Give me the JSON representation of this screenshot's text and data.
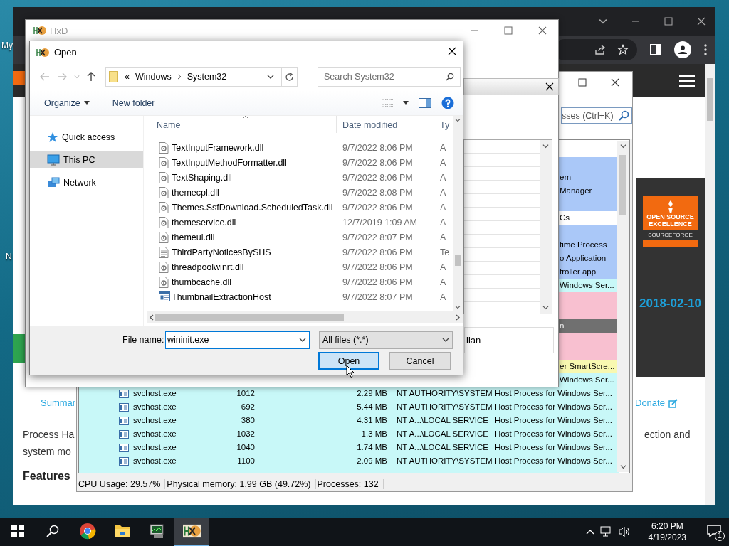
{
  "desktop_icons": [
    {
      "label": "My"
    },
    {
      "label": "N"
    }
  ],
  "browser": {
    "badge": {
      "title": "OPEN SOURCE EXCELLENCE",
      "brand": "SOURCEFORGE"
    },
    "date": "2018-02-10",
    "link": "Summar",
    "donate": "Donate",
    "paragraph_lines": [
      "Process Ha",
      "system mo"
    ],
    "paragraph_right": "ection and",
    "heading": "Features"
  },
  "process_hacker": {
    "search": {
      "placeholder": "sses (Ctrl+K)"
    },
    "partial_rows": [
      {
        "color": "#aac8f8"
      },
      {
        "text": "em",
        "color": "#aac8f8"
      },
      {
        "text": "Manager",
        "color": "#aac8f8"
      },
      {
        "color": "#aac8f8"
      },
      {
        "text": "Cs",
        "color": "#ffffff"
      },
      {
        "color": "#aac8f8"
      },
      {
        "text": "time Process",
        "color": "#aac8f8"
      },
      {
        "text": "o Application",
        "color": "#aac8f8"
      },
      {
        "text": "troller app",
        "color": "#aac8f8"
      },
      {
        "text": "Windows Ser...",
        "color": "#c8f8f8"
      },
      {
        "color": "#f8c0d0"
      },
      {
        "color": "#f8c0d0"
      },
      {
        "text": "n",
        "color": "#707070"
      },
      {
        "color": "#f8c0d0"
      },
      {
        "color": "#f8c0d0"
      },
      {
        "text": "er SmartScre...",
        "color": "#f8f8b0"
      },
      {
        "text": "Windows Ser...",
        "color": "#c8f8f8"
      }
    ],
    "rows": [
      {
        "name": "svchost.exe",
        "pid": "1012",
        "memory": "2.29 MB",
        "user": "NT AUTHORITY\\SYSTEM",
        "description": "Host Process for Windows Ser...",
        "color": "#c8f8f8"
      },
      {
        "name": "svchost.exe",
        "pid": "692",
        "memory": "5.44 MB",
        "user": "NT AUTHORITY\\SYSTEM",
        "description": "Host Process for Windows Ser...",
        "color": "#c8f8f8"
      },
      {
        "name": "svchost.exe",
        "pid": "380",
        "memory": "4.31 MB",
        "user": "NT A...\\LOCAL SERVICE",
        "description": "Host Process for Windows Ser...",
        "color": "#c8f8f8"
      },
      {
        "name": "svchost.exe",
        "pid": "1032",
        "memory": "1.3 MB",
        "user": "NT A...\\LOCAL SERVICE",
        "description": "Host Process for Windows Ser...",
        "color": "#c8f8f8"
      },
      {
        "name": "svchost.exe",
        "pid": "1040",
        "memory": "1.74 MB",
        "user": "NT A...\\LOCAL SERVICE",
        "description": "Host Process for Windows Ser...",
        "color": "#c8f8f8"
      },
      {
        "name": "svchost.exe",
        "pid": "1100",
        "memory": "2.09 MB",
        "user": "NT AUTHORITY\\SYSTEM",
        "description": "Host Process for Windows Ser...",
        "color": "#c8f8f8"
      }
    ],
    "status_bar": [
      "CPU Usage: 29.57%",
      "Physical memory: 1.99 GB (49.72%)",
      "Processes: 132"
    ]
  },
  "hxd": {
    "title": "HxD",
    "field_value": "lian"
  },
  "open_dialog": {
    "title": "Open",
    "path_overflow": "«",
    "path": [
      "Windows",
      "System32"
    ],
    "search": {
      "placeholder": "Search System32"
    },
    "toolbar": [
      "Organize",
      "New folder"
    ],
    "nav": [
      {
        "label": "Quick access",
        "kind": "quick",
        "selected": false
      },
      {
        "label": "This PC",
        "kind": "pc",
        "selected": true
      },
      {
        "label": "Network",
        "kind": "network",
        "selected": false
      }
    ],
    "columns": [
      "Name",
      "Date modified",
      "Ty"
    ],
    "files": [
      {
        "name": "TextInputFramework.dll",
        "date": "9/7/2022 8:06 PM",
        "type": "A",
        "kind": "dll"
      },
      {
        "name": "TextInputMethodFormatter.dll",
        "date": "9/7/2022 8:06 PM",
        "type": "A",
        "kind": "dll"
      },
      {
        "name": "TextShaping.dll",
        "date": "9/7/2022 8:06 PM",
        "type": "A",
        "kind": "dll"
      },
      {
        "name": "themecpl.dll",
        "date": "9/7/2022 8:08 PM",
        "type": "A",
        "kind": "dll"
      },
      {
        "name": "Themes.SsfDownload.ScheduledTask.dll",
        "date": "9/7/2022 8:06 PM",
        "type": "A",
        "kind": "dll"
      },
      {
        "name": "themeservice.dll",
        "date": "12/7/2019 1:09 AM",
        "type": "A",
        "kind": "dll"
      },
      {
        "name": "themeui.dll",
        "date": "9/7/2022 8:07 PM",
        "type": "A",
        "kind": "dll"
      },
      {
        "name": "ThirdPartyNoticesBySHS",
        "date": "9/7/2022 8:06 PM",
        "type": "Te",
        "kind": "text"
      },
      {
        "name": "threadpoolwinrt.dll",
        "date": "9/7/2022 8:06 PM",
        "type": "A",
        "kind": "dll"
      },
      {
        "name": "thumbcache.dll",
        "date": "9/7/2022 8:06 PM",
        "type": "A",
        "kind": "dll"
      },
      {
        "name": "ThumbnailExtractionHost",
        "date": "9/7/2022 8:07 PM",
        "type": "A",
        "kind": "exe"
      }
    ],
    "file_name_label": "File name:",
    "file_name": "wininit.exe",
    "filter": "All files (*.*)",
    "buttons": [
      {
        "label": "Open",
        "default": true
      },
      {
        "label": "Cancel",
        "default": false
      }
    ]
  },
  "taskbar": {
    "apps": [
      {
        "kind": "chrome",
        "active": false
      },
      {
        "kind": "folder",
        "active": false
      },
      {
        "kind": "monitor",
        "active": false
      },
      {
        "kind": "hxd",
        "active": true
      }
    ],
    "time": "6:20 PM",
    "date": "4/19/2023",
    "notifications": "1"
  }
}
